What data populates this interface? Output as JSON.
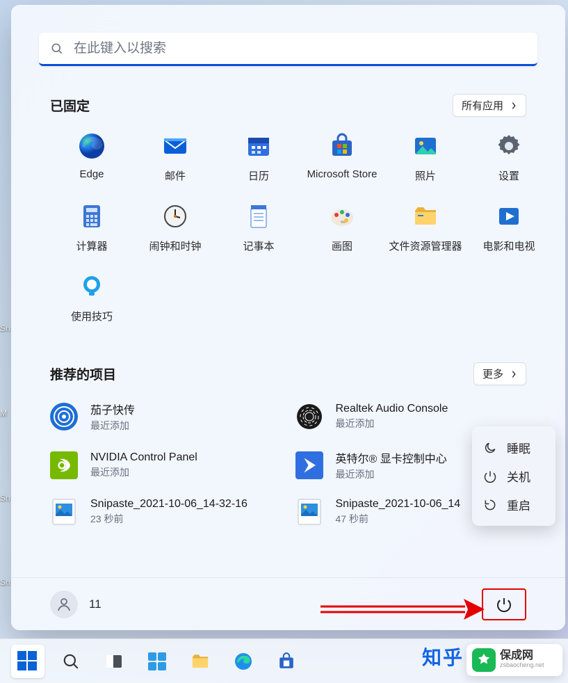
{
  "search": {
    "placeholder": "在此键入以搜索"
  },
  "pinned": {
    "title": "已固定",
    "all_apps": "所有应用",
    "items": [
      {
        "id": "edge",
        "label": "Edge"
      },
      {
        "id": "mail",
        "label": "邮件"
      },
      {
        "id": "calendar",
        "label": "日历"
      },
      {
        "id": "msstore",
        "label": "Microsoft Store"
      },
      {
        "id": "photos",
        "label": "照片"
      },
      {
        "id": "settings",
        "label": "设置"
      },
      {
        "id": "calc",
        "label": "计算器"
      },
      {
        "id": "alarms",
        "label": "闹钟和时钟"
      },
      {
        "id": "notepad",
        "label": "记事本"
      },
      {
        "id": "paint",
        "label": "画图"
      },
      {
        "id": "explorer",
        "label": "文件资源管理器"
      },
      {
        "id": "video",
        "label": "电影和电视"
      },
      {
        "id": "tips",
        "label": "使用技巧"
      }
    ]
  },
  "recommended": {
    "title": "推荐的项目",
    "more": "更多",
    "items": [
      {
        "id": "qiezi",
        "title": "茄子快传",
        "sub": "最近添加"
      },
      {
        "id": "realtek",
        "title": "Realtek Audio Console",
        "sub": "最近添加"
      },
      {
        "id": "nvidia",
        "title": "NVIDIA Control Panel",
        "sub": "最近添加"
      },
      {
        "id": "intel",
        "title": "英特尔® 显卡控制中心",
        "sub": "最近添加"
      },
      {
        "id": "snip1",
        "title": "Snipaste_2021-10-06_14-32-16",
        "sub": "23 秒前"
      },
      {
        "id": "snip2",
        "title": "Snipaste_2021-10-06_14",
        "sub": "47 秒前"
      }
    ]
  },
  "user": {
    "name": "11"
  },
  "power_menu": {
    "sleep": "睡眠",
    "shutdown": "关机",
    "restart": "重启"
  },
  "desktop": {
    "labels": [
      "Sn",
      "M",
      "Sn",
      "Sn"
    ]
  },
  "watermark": {
    "title": "保成网",
    "url": "zsbaocheng.net"
  },
  "peek": "知乎"
}
